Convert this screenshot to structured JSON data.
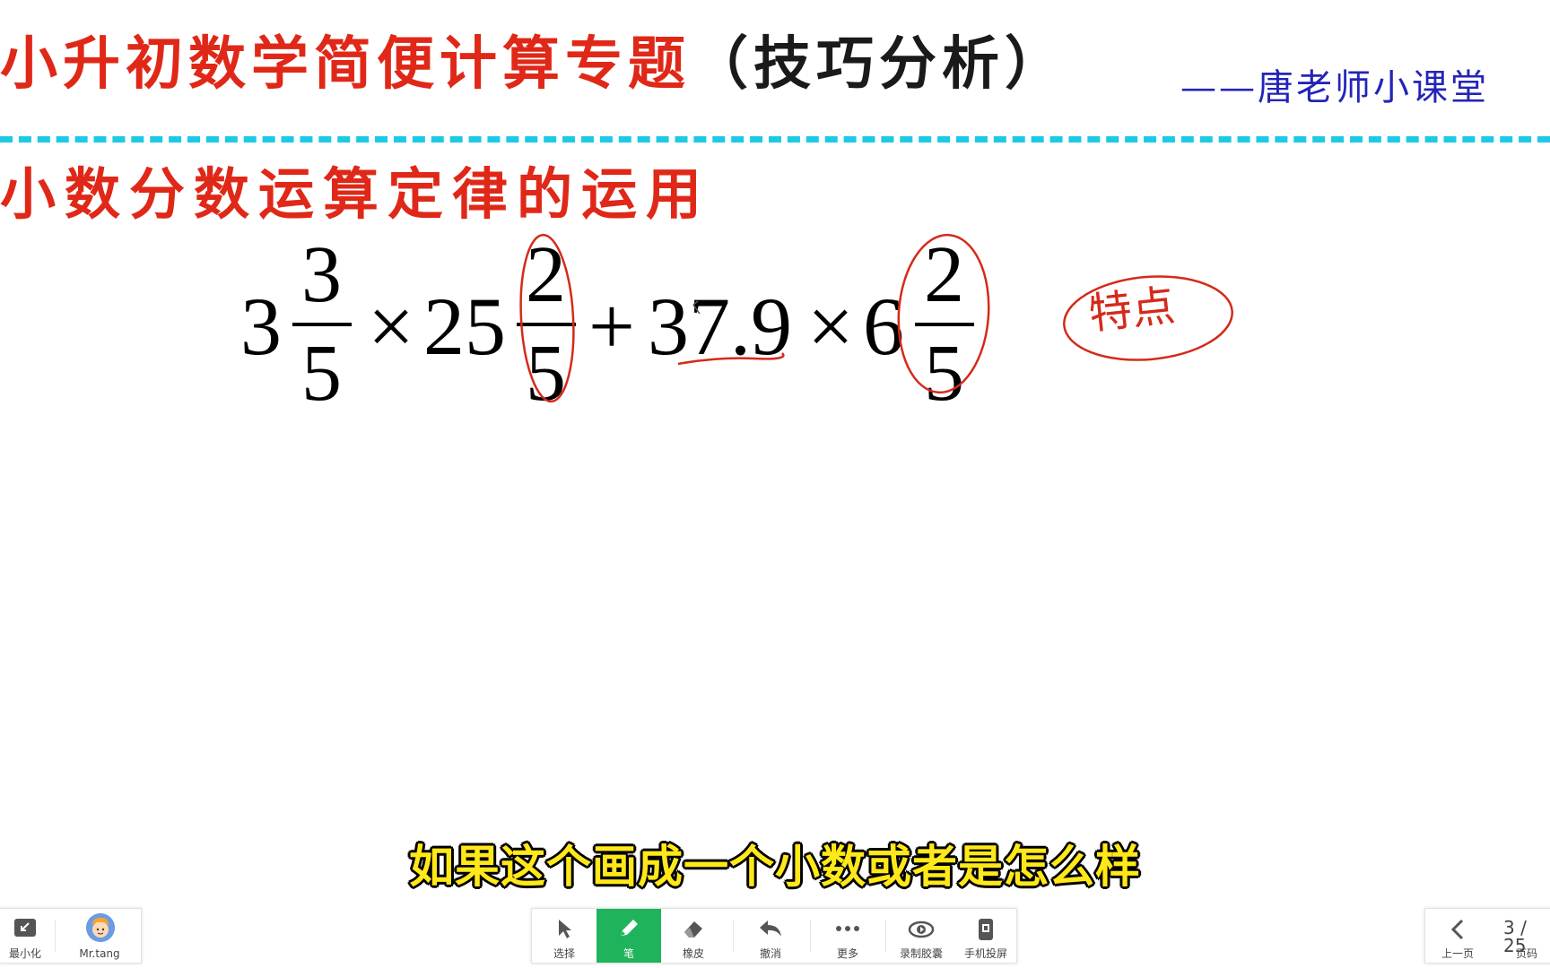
{
  "header": {
    "title_red": "小升初数学简便计算专题",
    "title_dark": "（技巧分析）",
    "author": "——唐老师小课堂"
  },
  "section": {
    "subtitle": "小数分数运算定律的运用"
  },
  "expression": {
    "whole_1": "3",
    "num_1": "3",
    "den_1": "5",
    "times_1": "×",
    "whole_2": "25",
    "num_2": "2",
    "den_2": "5",
    "plus": "+",
    "decimal": "37.9",
    "times_2": "×",
    "whole_3": "6",
    "num_3": "2",
    "den_3": "5"
  },
  "annotation": {
    "note": "特点"
  },
  "caption": "如果这个画成一个小数或者是怎么样",
  "toolbar_left": {
    "minimize_label": "最小化",
    "user_name": "Mr.tang"
  },
  "toolbar_center": {
    "select_label": "选择",
    "pen_label": "笔",
    "eraser_label": "橡皮",
    "undo_label": "撤消",
    "more_label": "更多",
    "record_label": "录制胶囊",
    "cast_label": "手机投屏"
  },
  "toolbar_right": {
    "prev_label": "上一页",
    "page_label": "页码",
    "page_indicator": "3 / 25"
  },
  "colors": {
    "title_red": "#e02818",
    "author_blue": "#2424b8",
    "divider_cyan": "#1ec9e6",
    "ink_red": "#d42a1a",
    "caption_yellow": "#ffe81a",
    "active_green": "#1fb35c"
  }
}
